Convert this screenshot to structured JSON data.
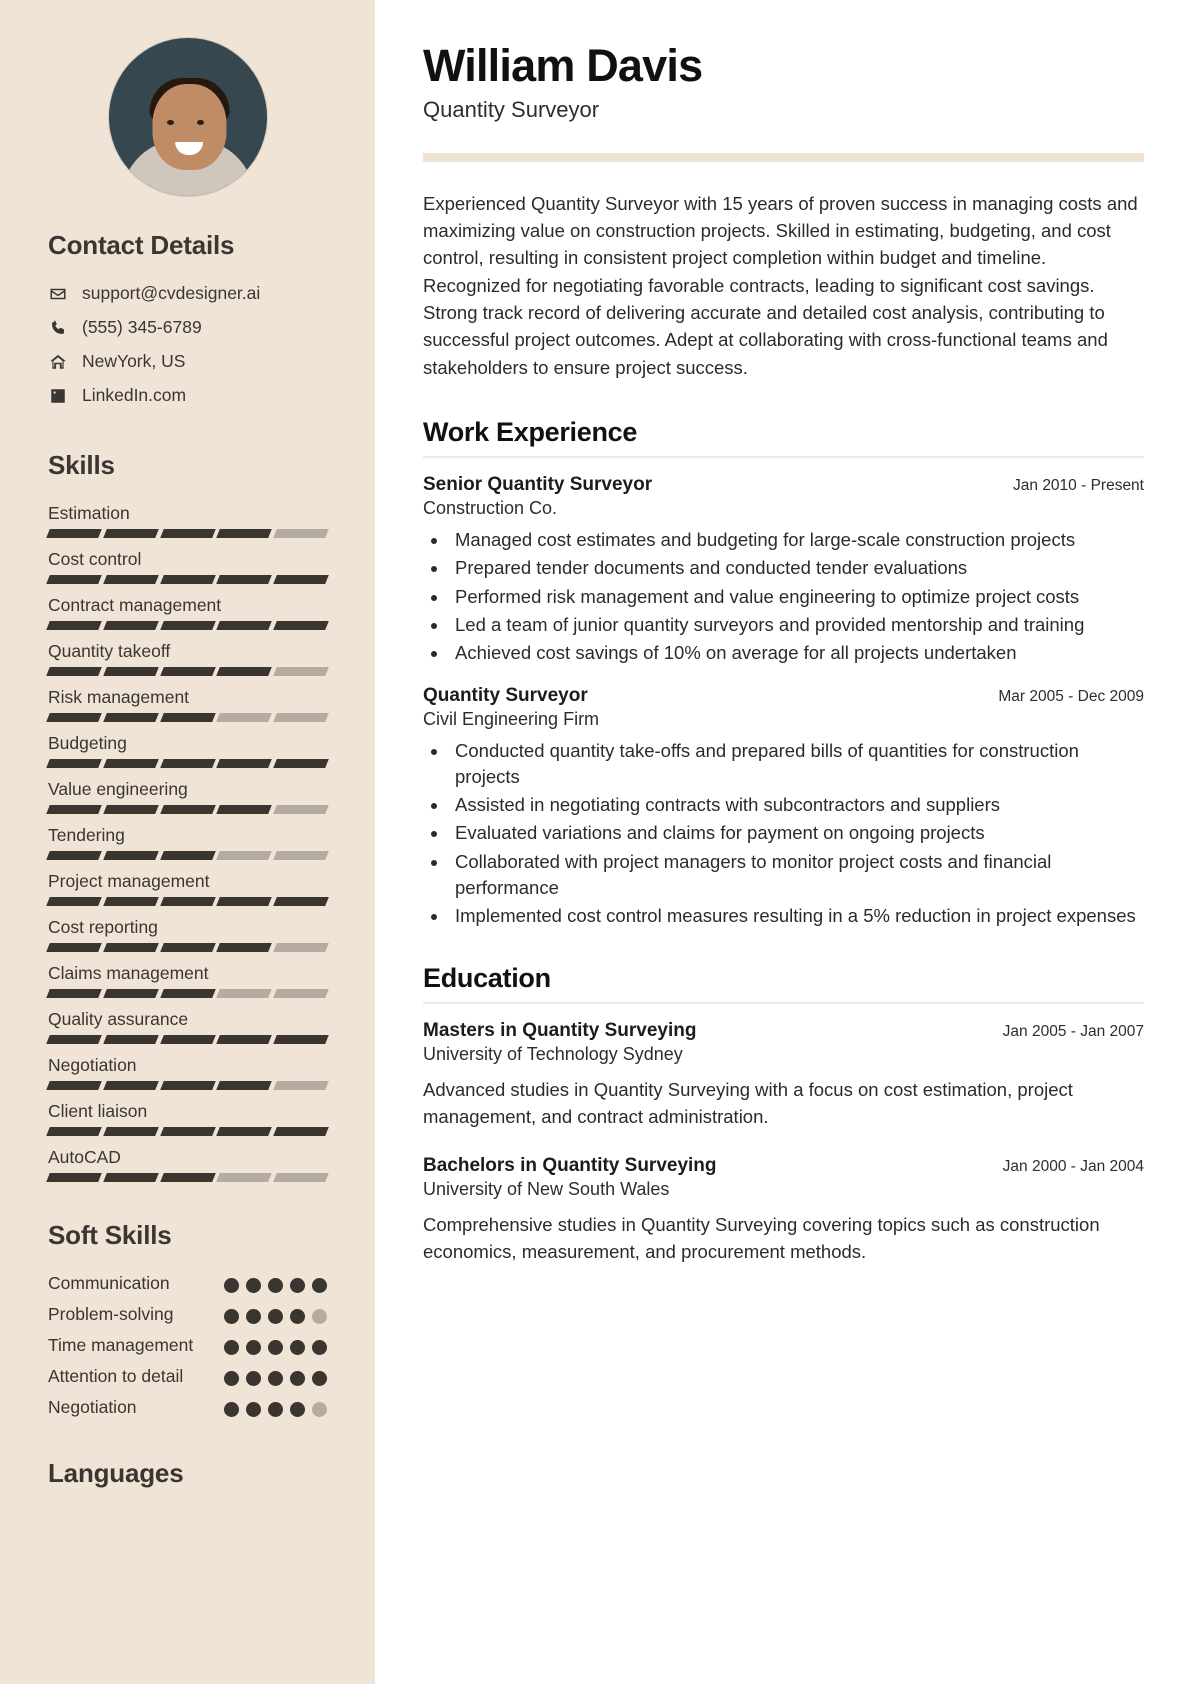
{
  "header": {
    "name": "William Davis",
    "role": "Quantity Surveyor"
  },
  "summary": "Experienced Quantity Surveyor with 15 years of proven success in managing costs and maximizing value on construction projects. Skilled in estimating, budgeting, and cost control, resulting in consistent project completion within budget and timeline. Recognized for negotiating favorable contracts, leading to significant cost savings. Strong track record of delivering accurate and detailed cost analysis, contributing to successful project outcomes. Adept at collaborating with cross-functional teams and stakeholders to ensure project success.",
  "sidebar": {
    "contact_heading": "Contact Details",
    "contact": [
      {
        "icon": "envelope-icon",
        "value": "support@cvdesigner.ai"
      },
      {
        "icon": "phone-icon",
        "value": "(555) 345-6789"
      },
      {
        "icon": "home-icon",
        "value": "NewYork, US"
      },
      {
        "icon": "linkedin-icon",
        "value": "LinkedIn.com"
      }
    ],
    "skills_heading": "Skills",
    "skills": [
      {
        "name": "Estimation",
        "level": 4,
        "max": 5
      },
      {
        "name": "Cost control",
        "level": 5,
        "max": 5
      },
      {
        "name": "Contract management",
        "level": 5,
        "max": 5
      },
      {
        "name": "Quantity takeoff",
        "level": 4,
        "max": 5
      },
      {
        "name": "Risk management",
        "level": 3,
        "max": 5
      },
      {
        "name": "Budgeting",
        "level": 5,
        "max": 5
      },
      {
        "name": "Value engineering",
        "level": 4,
        "max": 5
      },
      {
        "name": "Tendering",
        "level": 3,
        "max": 5
      },
      {
        "name": "Project management",
        "level": 5,
        "max": 5
      },
      {
        "name": "Cost reporting",
        "level": 4,
        "max": 5
      },
      {
        "name": "Claims management",
        "level": 3,
        "max": 5
      },
      {
        "name": "Quality assurance",
        "level": 5,
        "max": 5
      },
      {
        "name": "Negotiation",
        "level": 4,
        "max": 5
      },
      {
        "name": "Client liaison",
        "level": 5,
        "max": 5
      },
      {
        "name": "AutoCAD",
        "level": 3,
        "max": 5
      }
    ],
    "soft_skills_heading": "Soft Skills",
    "soft_skills": [
      {
        "name": "Communication",
        "level": 5,
        "max": 5
      },
      {
        "name": "Problem-solving",
        "level": 4,
        "max": 5
      },
      {
        "name": "Time management",
        "level": 5,
        "max": 5
      },
      {
        "name": "Attention to detail",
        "level": 5,
        "max": 5
      },
      {
        "name": "Negotiation",
        "level": 4,
        "max": 5
      }
    ],
    "languages_heading": "Languages"
  },
  "work": {
    "title": "Work Experience",
    "entries": [
      {
        "role": "Senior Quantity Surveyor",
        "org": "Construction Co.",
        "date": "Jan 2010 - Present",
        "bullets": [
          "Managed cost estimates and budgeting for large-scale construction projects",
          "Prepared tender documents and conducted tender evaluations",
          "Performed risk management and value engineering to optimize project costs",
          "Led a team of junior quantity surveyors and provided mentorship and training",
          "Achieved cost savings of 10% on average for all projects undertaken"
        ]
      },
      {
        "role": "Quantity Surveyor",
        "org": "Civil Engineering Firm",
        "date": "Mar 2005 - Dec 2009",
        "bullets": [
          "Conducted quantity take-offs and prepared bills of quantities for construction projects",
          "Assisted in negotiating contracts with subcontractors and suppliers",
          "Evaluated variations and claims for payment on ongoing projects",
          "Collaborated with project managers to monitor project costs and financial performance",
          "Implemented cost control measures resulting in a 5% reduction in project expenses"
        ]
      }
    ]
  },
  "education": {
    "title": "Education",
    "entries": [
      {
        "degree": "Masters in Quantity Surveying",
        "school": "University of Technology Sydney",
        "date": "Jan 2005 - Jan 2007",
        "desc": "Advanced studies in Quantity Surveying with a focus on cost estimation, project management, and contract administration."
      },
      {
        "degree": "Bachelors in Quantity Surveying",
        "school": "University of New South Wales",
        "date": "Jan 2000 - Jan 2004",
        "desc": "Comprehensive studies in Quantity Surveying covering topics such as construction economics, measurement, and procurement methods."
      }
    ]
  },
  "colors": {
    "sidebar_bg": "#f0e4d7",
    "accent_rule": "#efe3d5",
    "filled": "#3a352f",
    "empty": "#b5aca1"
  }
}
